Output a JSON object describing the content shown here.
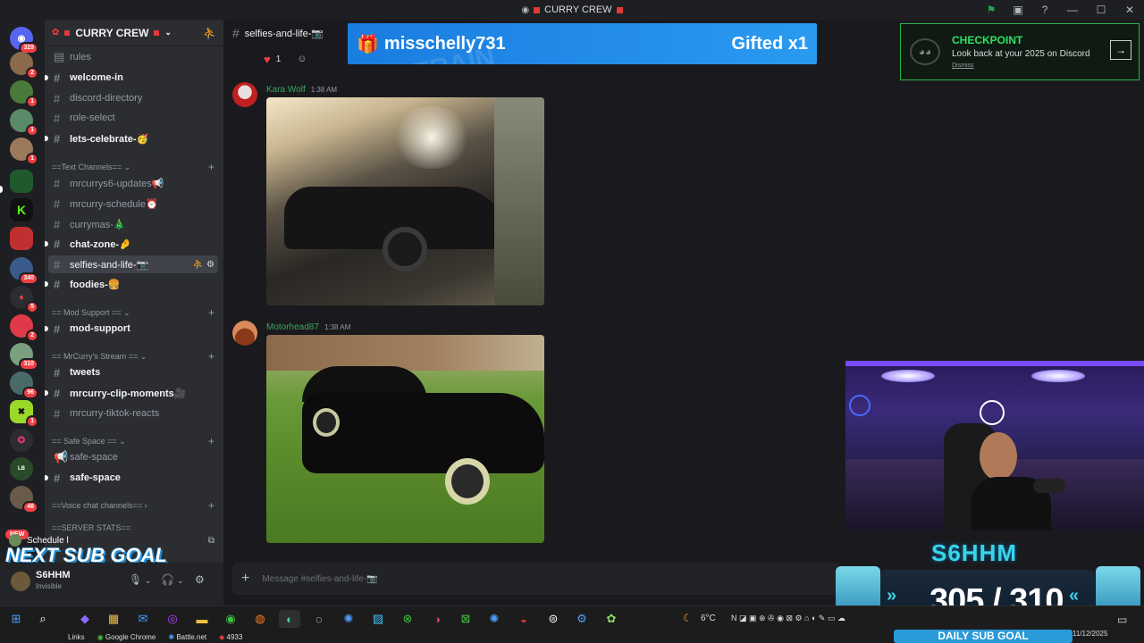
{
  "window": {
    "title": "CURRY CREW"
  },
  "servers": {
    "badges": [
      "329",
      "2",
      "1",
      "1",
      "1",
      "340",
      "5",
      "2",
      "310",
      "96",
      "1",
      "46"
    ],
    "new_label": "NEW"
  },
  "guild": {
    "name": "CURRY CREW"
  },
  "channels": {
    "rules": "rules",
    "welcome": "welcome-in",
    "directory": "discord-directory",
    "role_select": "role-select",
    "celebrate": "lets-celebrate-🥳",
    "cat_text": "==Text Channels==",
    "updates": "mrcurrys6-updates📢",
    "schedule": "mrcurry-schedule⏰",
    "currymas": "currymas-🎄",
    "chat_zone": "chat-zone-🤌",
    "selfies": "selfies-and-life-📷",
    "foodies": "foodies-🍔",
    "cat_mod": "== Mod Support ==",
    "mod_support": "mod-support",
    "cat_stream": "== MrCurry's Stream ==",
    "tweets": "tweets",
    "clip_moments": "mrcurry-clip-moments🎥",
    "tiktok": "mrcurry-tiktok-reacts",
    "cat_safe": "== Safe Space ==",
    "safe_announce": "safe-space",
    "safe_space": "safe-space",
    "cat_voice": "==Voice chat channels==",
    "cat_stats": "==SERVER STATS=="
  },
  "user": {
    "name": "S6HHM",
    "status": "Invisible"
  },
  "overlay": {
    "schedule": "Schedule l",
    "next_sub_goal": "NEXT SUB GOAL",
    "goal_name": "S6HHM",
    "goal_count": "305 / 310",
    "goal_label": "DAILY SUB GOAL"
  },
  "chat": {
    "channel_name": "selfies-and-life-📷",
    "reaction_count": "1",
    "banner_user": "misschelly731",
    "banner_gift": "Gifted x1",
    "banner_bg": "SUB TRAIN",
    "messages": [
      {
        "author": "Kara Wolf",
        "time": "1:38 AM"
      },
      {
        "author": "Motorhead87",
        "time": "1:38 AM"
      }
    ],
    "composer_placeholder": "Message #selfies-and-life-📷"
  },
  "checkpoint": {
    "title": "CHECKPOINT",
    "subtitle": "Look back at your 2025 on Discord",
    "dismiss": "Dismiss"
  },
  "taskbar": {
    "links_label": "Links",
    "link_chrome": "Google Chrome",
    "link_battlenet": "Battle.net",
    "link_count": "4933",
    "weather": "6°C",
    "date": "11/12/2025"
  },
  "colors": {
    "accent_green": "#2fe063",
    "discord_dark": "#1e1f22",
    "banner_blue": "#1a7de0",
    "goal_cyan": "#3ad4e8"
  }
}
